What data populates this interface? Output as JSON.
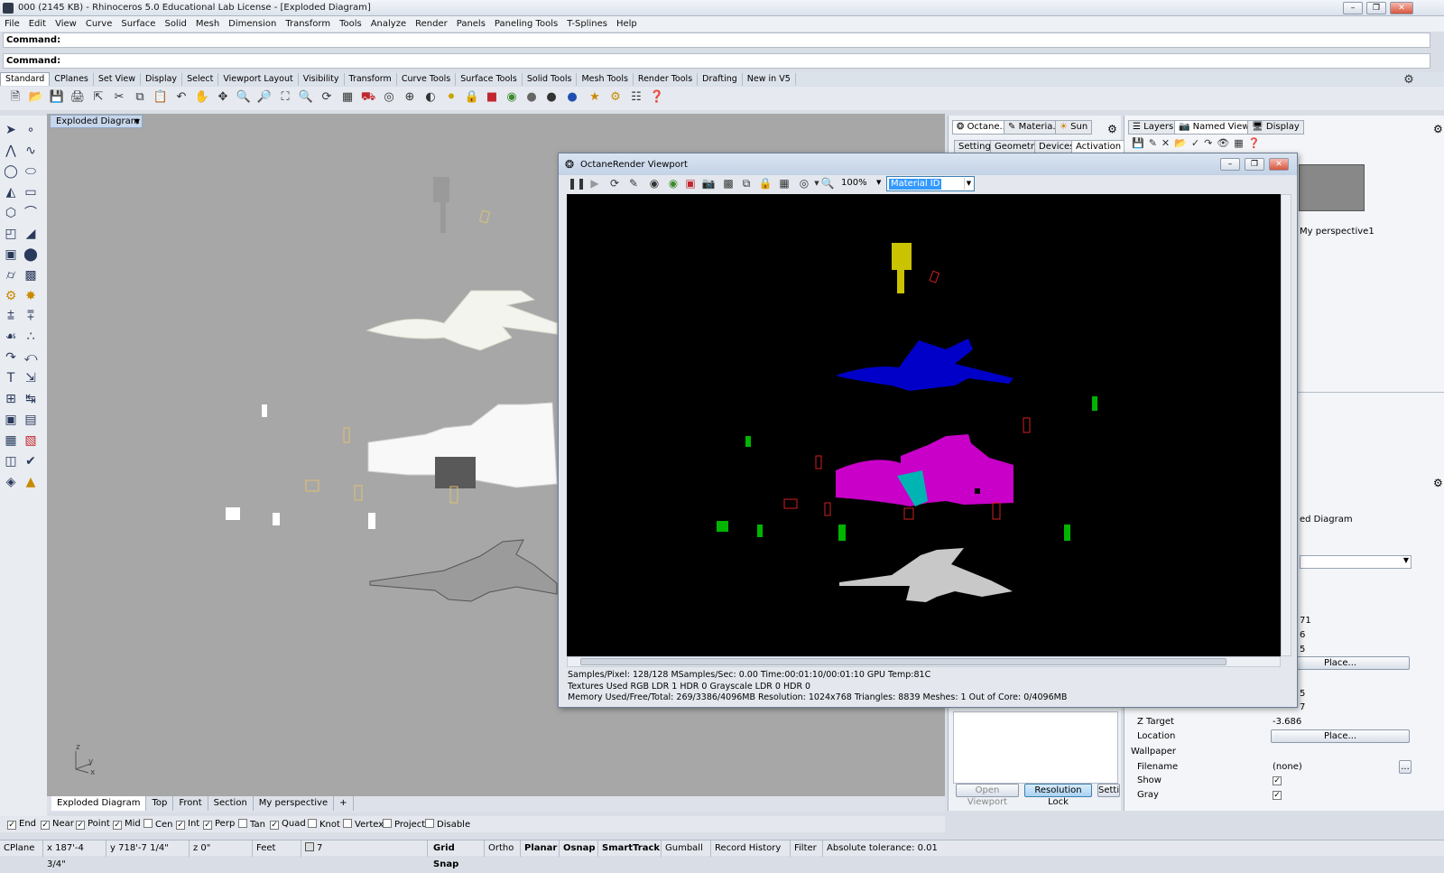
{
  "window": {
    "title": "000 (2145 KB) - Rhinoceros 5.0 Educational Lab License - [Exploded Diagram]"
  },
  "menu": [
    "File",
    "Edit",
    "View",
    "Curve",
    "Surface",
    "Solid",
    "Mesh",
    "Dimension",
    "Transform",
    "Tools",
    "Analyze",
    "Render",
    "Panels",
    "Paneling Tools",
    "T-Splines",
    "Help"
  ],
  "command": {
    "label": "Command:",
    "label2": "Command:"
  },
  "toolbar_tabs": [
    "Standard",
    "CPlanes",
    "Set View",
    "Display",
    "Select",
    "Viewport Layout",
    "Visibility",
    "Transform",
    "Curve Tools",
    "Surface Tools",
    "Solid Tools",
    "Mesh Tools",
    "Render Tools",
    "Drafting",
    "New in V5"
  ],
  "viewport": {
    "name": "Exploded Diagram",
    "axis": {
      "z": "z",
      "y": "y",
      "x": "x"
    }
  },
  "viewport_tabs": [
    "Exploded Diagram",
    "Top",
    "Front",
    "Section",
    "My perspective",
    "+"
  ],
  "osnaps": [
    {
      "label": "End",
      "checked": true
    },
    {
      "label": "Near",
      "checked": true
    },
    {
      "label": "Point",
      "checked": true
    },
    {
      "label": "Mid",
      "checked": true
    },
    {
      "label": "Cen",
      "checked": false
    },
    {
      "label": "Int",
      "checked": true
    },
    {
      "label": "Perp",
      "checked": true
    },
    {
      "label": "Tan",
      "checked": false
    },
    {
      "label": "Quad",
      "checked": true
    },
    {
      "label": "Knot",
      "checked": false
    },
    {
      "label": "Vertex",
      "checked": false
    },
    {
      "label": "Project",
      "checked": false
    },
    {
      "label": "Disable",
      "checked": false
    }
  ],
  "status": {
    "cplane": "CPlane",
    "x": "x 187'-4 3/4\"",
    "y": "y 718'-7 1/4\"",
    "z": "z 0\"",
    "units": "Feet",
    "layer": "7",
    "grid_snap": "Grid Snap",
    "ortho": "Ortho",
    "planar": "Planar",
    "osnap": "Osnap",
    "smarttrack": "SmartTrack",
    "gumball": "Gumball",
    "record_history": "Record History",
    "filter": "Filter",
    "tolerance": "Absolute tolerance: 0.01"
  },
  "mid_panel": {
    "tabs": [
      "Octane..",
      "Materia..",
      "Sun"
    ],
    "subtabs": [
      "Settings",
      "Geometry",
      "Devices",
      "Activation"
    ],
    "open_viewport": "Open Viewport",
    "resolution_lock": "Resolution Lock",
    "settings": "Setti"
  },
  "right_panel": {
    "tabs": [
      "Layers",
      "Named Views",
      "Display"
    ],
    "thumb_label": "My perspective1",
    "named_partial": "ed Diagram",
    "values_partial": [
      "71",
      "6",
      "5"
    ],
    "place": "Place...",
    "values_partial2": [
      "5",
      "7"
    ],
    "z_target_label": "Z Target",
    "z_target": "-3.686",
    "location_label": "Location",
    "location_btn": "Place...",
    "wallpaper": "Wallpaper",
    "filename_label": "Filename",
    "filename": "(none)",
    "show_label": "Show",
    "gray_label": "Gray",
    "browse": "..."
  },
  "octane": {
    "title": "OctaneRender Viewport",
    "zoom": "100%",
    "mode": "Material ID",
    "stats": [
      "Samples/Pixel: 128/128   MSamples/Sec: 0.00   Time:00:01:10/00:01:10   GPU Temp:81C",
      "Textures Used RGB LDR 1   HDR 0   Grayscale LDR 0   HDR 0",
      "Memory Used/Free/Total: 269/3386/4096MB   Resolution: 1024x768   Triangles: 8839   Meshes: 1 Out of Core: 0/4096MB"
    ]
  }
}
